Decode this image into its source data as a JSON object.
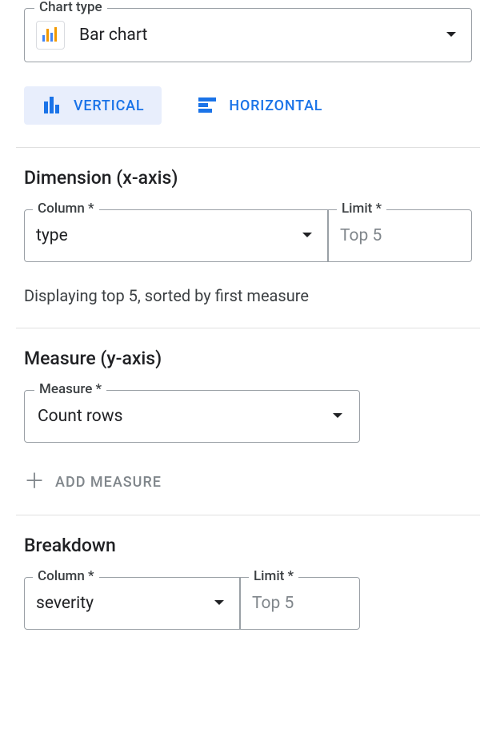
{
  "chartType": {
    "label": "Chart type",
    "value": "Bar chart",
    "icon": "bar-chart-icon"
  },
  "orientation": {
    "vertical": "VERTICAL",
    "horizontal": "HORIZONTAL",
    "selected": "vertical"
  },
  "dimension": {
    "heading": "Dimension (x-axis)",
    "column": {
      "label": "Column *",
      "value": "type"
    },
    "limit": {
      "label": "Limit *",
      "value": "Top 5"
    },
    "helper": "Displaying top 5, sorted by first measure"
  },
  "measure": {
    "heading": "Measure (y-axis)",
    "field": {
      "label": "Measure *",
      "value": "Count rows"
    },
    "add_label": "ADD MEASURE"
  },
  "breakdown": {
    "heading": "Breakdown",
    "column": {
      "label": "Column *",
      "value": "severity"
    },
    "limit": {
      "label": "Limit *",
      "value": "Top 5"
    }
  }
}
